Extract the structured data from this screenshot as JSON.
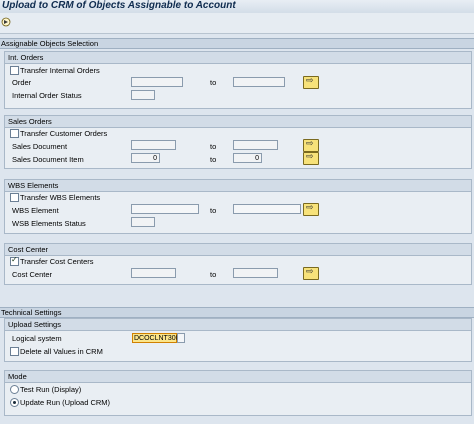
{
  "title": "Upload to CRM of Objects Assignable to Account",
  "toolbar": {
    "execute_icon": "execute-icon"
  },
  "assignable_section": {
    "label": "Assignable Objects Selection"
  },
  "int_orders": {
    "group_title": "Int. Orders",
    "transfer_label": "Transfer Internal Orders",
    "order_label": "Order",
    "to_label": "to",
    "status_label": "Internal Order Status"
  },
  "sales_orders": {
    "group_title": "Sales Orders",
    "transfer_label": "Transfer Customer Orders",
    "doc_label": "Sales Document",
    "to_label": "to",
    "item_label": "Sales Document Item",
    "item_from_value": "0",
    "item_to_value": "0"
  },
  "wbs": {
    "group_title": "WBS Elements",
    "transfer_label": "Transfer WBS Elements",
    "element_label": "WBS Element",
    "to_label": "to",
    "status_label": "WSB Elements Status"
  },
  "cost_center": {
    "group_title": "Cost Center",
    "transfer_label": "Transfer Cost Centers",
    "transfer_checked": true,
    "cc_label": "Cost Center",
    "to_label": "to"
  },
  "technical_section": {
    "label": "Technical Settings"
  },
  "upload_settings": {
    "group_title": "Upload Settings",
    "logical_system_label": "Logical system",
    "logical_system_value": "DCOCLNT300",
    "delete_label": "Delete all Values in CRM"
  },
  "mode": {
    "group_title": "Mode",
    "test_run_label": "Test Run (Display)",
    "update_run_label": "Update Run (Upload CRM)",
    "selected": "update"
  },
  "colors": {
    "multi_button": "#f7e27a",
    "logical_field_highlight": "#fbe58a"
  }
}
